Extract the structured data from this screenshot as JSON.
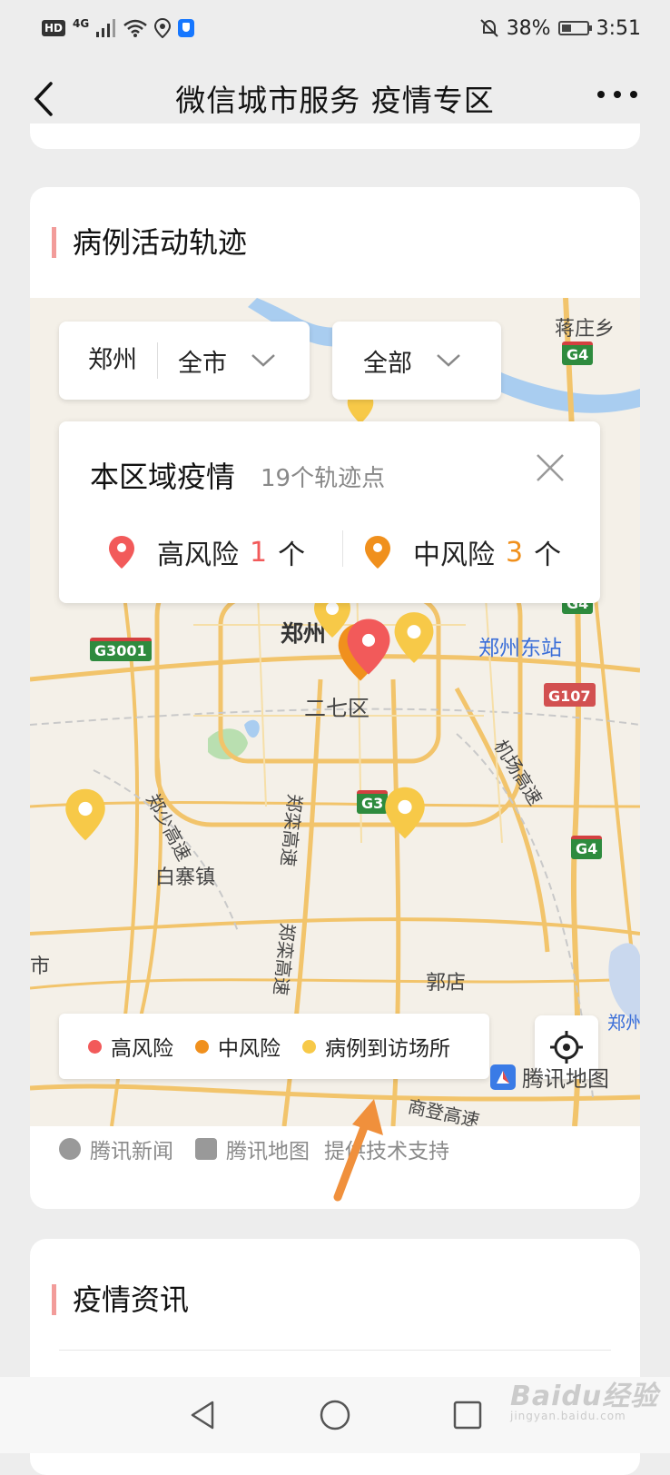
{
  "status": {
    "hd": "HD",
    "network": "4G",
    "battery": "38%",
    "time": "3:51"
  },
  "nav": {
    "title": "微信城市服务 疫情专区"
  },
  "track_section": {
    "title": "病例活动轨迹",
    "city_selector": {
      "city": "郑州",
      "area": "全市"
    },
    "type_selector": {
      "value": "全部"
    },
    "info": {
      "title": "本区域疫情",
      "subtitle": "19个轨迹点",
      "high": {
        "label": "高风险",
        "count": "1",
        "unit": "个"
      },
      "mid": {
        "label": "中风险",
        "count": "3",
        "unit": "个"
      }
    },
    "legend": {
      "high": "高风险",
      "mid": "中风险",
      "visit": "病例到访场所"
    },
    "map_labels": {
      "jiangzhuang": "蒋庄乡",
      "zhengzhou": "郑州",
      "erqi": "二七区",
      "zz_east": "郑州东站",
      "baizhai": "白寨镇",
      "guodian": "郭店",
      "road_zs": "郑少高速",
      "road_zl1": "郑栾高速",
      "road_zl2": "郑栾高速",
      "road_jc": "机场高速",
      "road_sd": "商登高速",
      "edge_shi": "市",
      "airport": "郑州新郑国际机场",
      "tx_map": "腾讯地图"
    },
    "shields": {
      "g4_a": "G4",
      "g4_b": "G4",
      "g4_c": "G4",
      "g3001": "G3001",
      "g107": "G107",
      "g3": "G3"
    },
    "support": {
      "news": "腾讯新闻",
      "map": "腾讯地图",
      "text": "提供技术支持"
    }
  },
  "news_section": {
    "title": "疫情资讯"
  },
  "watermark": {
    "text": "Baidu经验",
    "sub": "jingyan.baidu.com"
  },
  "colors": {
    "high": "#f25a5a",
    "mid": "#f0901d",
    "visit": "#f7c948",
    "accent_bar": "#f29c9a"
  }
}
